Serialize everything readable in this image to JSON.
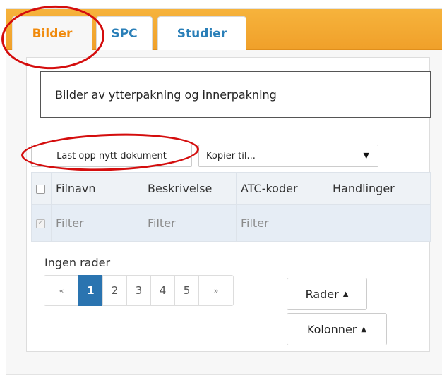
{
  "tabs": [
    {
      "label": "Bilder",
      "active": true
    },
    {
      "label": "SPC",
      "active": false
    },
    {
      "label": "Studier",
      "active": false
    }
  ],
  "description": "Bilder av ytterpakning og innerpakning",
  "toolbar": {
    "upload_label": "Last opp nytt dokument",
    "copy_label": "Kopier til..."
  },
  "table": {
    "columns": [
      "Filnavn",
      "Beskrivelse",
      "ATC-koder",
      "Handlinger"
    ],
    "filter_placeholders": [
      "Filter",
      "Filter",
      "Filter"
    ]
  },
  "empty_text": "Ingen rader",
  "pagination": {
    "prev": "«",
    "pages": [
      "1",
      "2",
      "3",
      "4",
      "5"
    ],
    "next": "»",
    "active_page": "1"
  },
  "buttons": {
    "rows_label": "Rader",
    "columns_label": "Kolonner"
  },
  "colors": {
    "tabbar": "#f0a02a",
    "active_tab_text": "#f08a0c",
    "tab_text": "#2a7fb8",
    "active_page": "#2a74b0",
    "annotation": "#d40d0d"
  }
}
